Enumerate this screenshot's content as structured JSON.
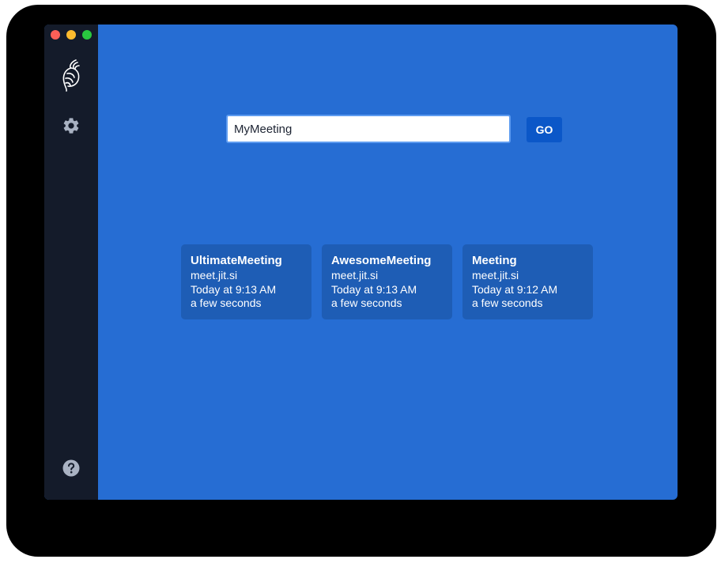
{
  "room_input": {
    "value": "MyMeeting"
  },
  "go_button": {
    "label": "GO"
  },
  "recent_meetings": [
    {
      "name": "UltimateMeeting",
      "server": "meet.jit.si",
      "date": "Today at 9:13 AM",
      "duration": "a few seconds"
    },
    {
      "name": "AwesomeMeeting",
      "server": "meet.jit.si",
      "date": "Today at 9:13 AM",
      "duration": "a few seconds"
    },
    {
      "name": "Meeting",
      "server": "meet.jit.si",
      "date": "Today at 9:12 AM",
      "duration": "a few seconds"
    }
  ],
  "icons": {
    "logo": "jitsi-logo-icon",
    "settings": "gear-icon",
    "help": "question-mark-icon"
  },
  "colors": {
    "background": "#266dd3",
    "sidebar": "#141b2a",
    "card": "#1e5db5",
    "go_button": "#0b57c8"
  }
}
